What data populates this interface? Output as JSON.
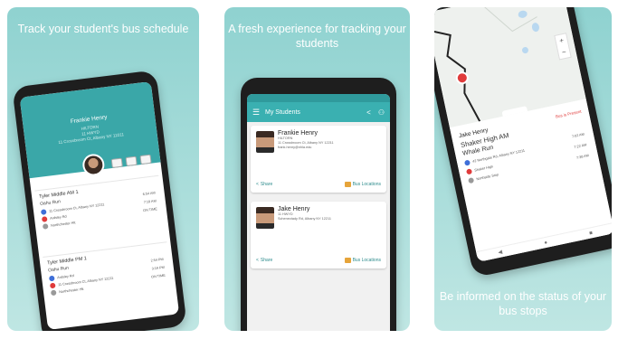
{
  "panels": [
    {
      "caption": "Track your student's bus schedule",
      "phone": {
        "header_name": "Frankie Henry",
        "header_lines": [
          "HILTORN",
          "11 HWYD",
          "11 Crossbroom Ct, Albany NY 12211"
        ],
        "cards": [
          {
            "title": "Tyler Middle AM 1",
            "run": "Oahu Run",
            "stops": [
              "11 Crossbroom Ct, Albany NY 12211",
              "Ardsley Rd",
              "Northchester Hlt"
            ],
            "times": [
              "6:54 AM",
              "7:19 AM",
              "ON TIME"
            ]
          },
          {
            "title": "Tyler Middle PM 1",
            "run": "Oahu Run",
            "stops": [
              "Ardsley Rd",
              "11 Crossbroom Ct, Albany NY 12211",
              "Northchester Hlt"
            ],
            "times": [
              "2:54 PM",
              "3:19 PM",
              "ON TIME"
            ]
          }
        ]
      }
    },
    {
      "caption": "A fresh experience for tracking your students",
      "phone": {
        "app_title": "My Students",
        "menu_icon": "menu-icon",
        "share_icon": "share-icon",
        "add_icon": "add-user-icon",
        "students": [
          {
            "name": "Frankie Henry",
            "lines": [
              "HILTORN",
              "11 Crossbroom Ct, Albany NY 12211",
              "frank.henry@nhla.edu"
            ],
            "share_label": "Share",
            "bus_label": "Bus Locations"
          },
          {
            "name": "Jake Henry",
            "lines": [
              "11 HWYD",
              "Schenectady Rd, Albany NY 12211"
            ],
            "share_label": "Share",
            "bus_label": "Bus Locations"
          }
        ]
      }
    },
    {
      "caption": "Be informed on the status of your bus stops",
      "phone": {
        "student_name": "Jake Henry",
        "school": "Shaker High AM",
        "run": "Whale Run",
        "status": "Bus is Present",
        "stops": [
          {
            "label": "42 Northgate Rd, Albany NY 12211",
            "time": "7:02 AM"
          },
          {
            "label": "Shaker High",
            "time": "7:22 AM"
          },
          {
            "label": "Northside Stop",
            "time": "7:38 AM"
          }
        ],
        "zoom_in": "+",
        "zoom_out": "−"
      }
    }
  ],
  "colors": {
    "panel_bg": "#8fd2d0",
    "teal": "#3ab0b1",
    "stop_blue": "#3f6fd8",
    "stop_red": "#e03b3b"
  }
}
